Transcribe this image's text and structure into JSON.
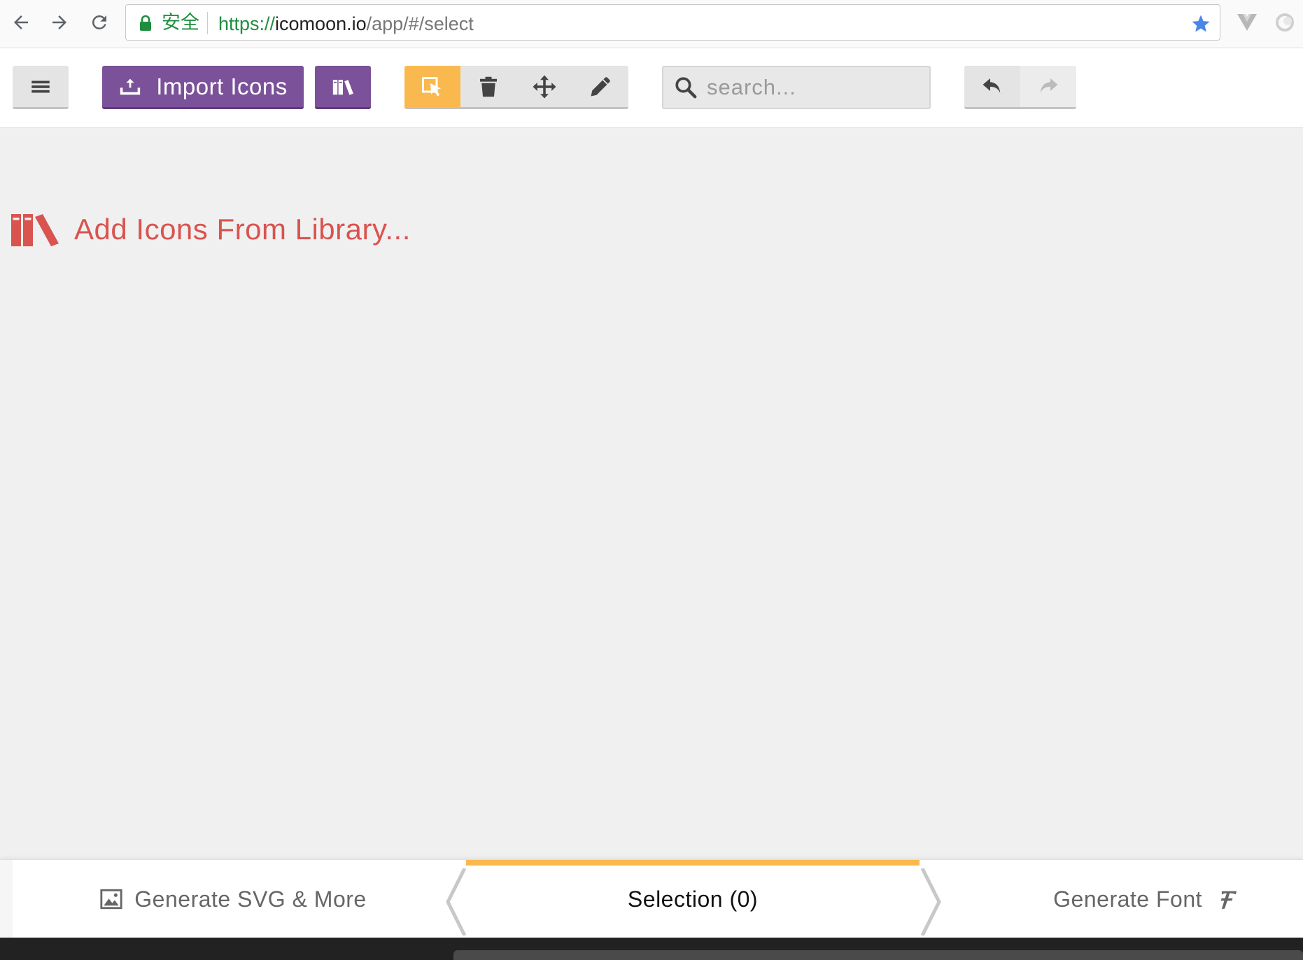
{
  "browser": {
    "secure_label": "安全",
    "url_scheme": "https://",
    "url_host": "icomoon.io",
    "url_path": "/app/#/select"
  },
  "toolbar": {
    "import_label": "Import Icons",
    "search_placeholder": "search..."
  },
  "main": {
    "add_library_label": "Add Icons From Library..."
  },
  "bottom": {
    "generate_svg_label": "Generate SVG & More",
    "selection_label": "Selection (0)",
    "generate_font_label": "Generate Font"
  },
  "colors": {
    "purple": "#7b5299",
    "yellow": "#f9b94f",
    "red": "#d9534f",
    "green": "#1e8e3e",
    "star_blue": "#4a86e8"
  }
}
